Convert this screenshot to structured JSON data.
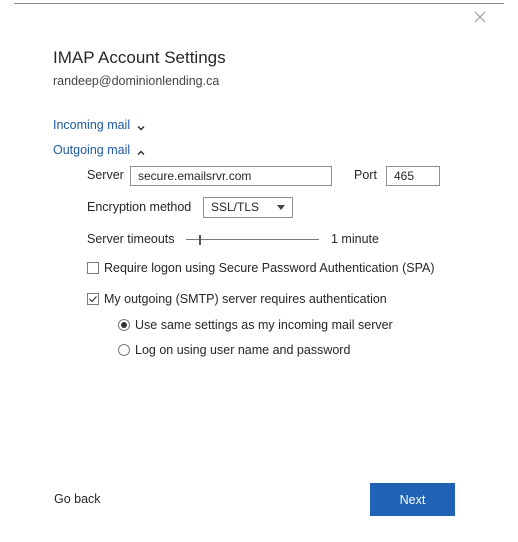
{
  "header": {
    "title": "IMAP Account Settings",
    "email": "randeep@dominionlending.ca"
  },
  "incoming": {
    "label": "Incoming mail",
    "expanded": false
  },
  "outgoing": {
    "label": "Outgoing mail",
    "expanded": true,
    "server_label": "Server",
    "server_value": "secure.emailsrvr.com",
    "port_label": "Port",
    "port_value": "465",
    "encryption_label": "Encryption method",
    "encryption_value": "SSL/TLS",
    "timeout_label": "Server timeouts",
    "timeout_value": "1 minute",
    "timeout_fraction": 0.1,
    "spa_label": "Require logon using Secure Password Authentication (SPA)",
    "spa_checked": false,
    "smtp_auth_label": "My outgoing (SMTP) server requires authentication",
    "smtp_auth_checked": true,
    "radio_same_label": "Use same settings as my incoming mail server",
    "radio_logon_label": "Log on using user name and password",
    "radio_selected": "same"
  },
  "footer": {
    "back_label": "Go back",
    "next_label": "Next"
  },
  "colors": {
    "link": "#1e5aa0",
    "primary_button": "#1f62b6"
  }
}
